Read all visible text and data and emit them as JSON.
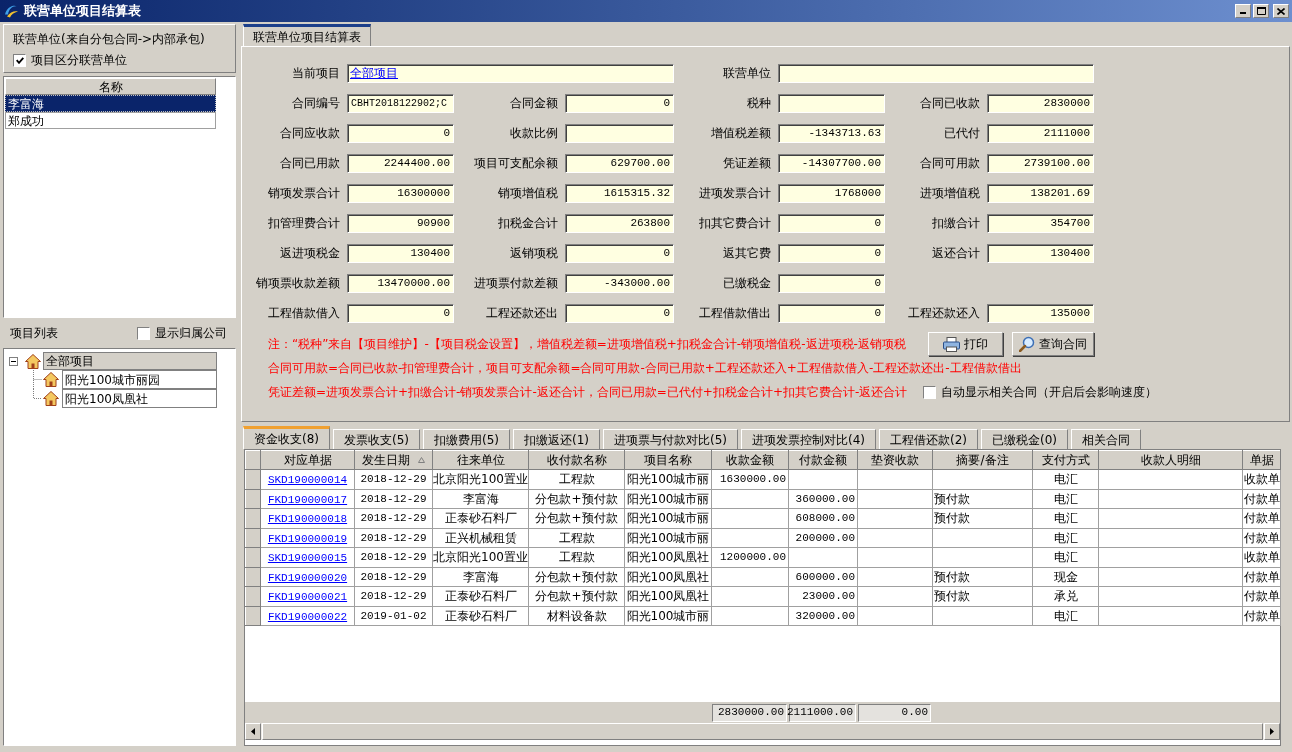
{
  "window": {
    "title": "联营单位项目结算表"
  },
  "left_panel": {
    "group_label": "联营单位(来自分包合同->内部承包)",
    "split_checkbox": {
      "label": "项目区分联营单位",
      "checked": true
    },
    "unit_list": {
      "column": "名称",
      "items": [
        {
          "name": "李富海",
          "selected": true
        },
        {
          "name": "郑成功",
          "selected": false
        }
      ]
    },
    "project_list": {
      "label": "项目列表",
      "company_checkbox": {
        "label": "显示归属公司",
        "checked": false
      },
      "tree": [
        {
          "label": "全部项目",
          "expanded": true,
          "selected": true,
          "children": [
            {
              "label": "阳光100城市丽园",
              "selected": false
            },
            {
              "label": "阳光100凤凰社",
              "selected": false
            }
          ]
        }
      ]
    }
  },
  "main_tabs": [
    {
      "label": "联营单位项目结算表",
      "selected": true
    }
  ],
  "form": {
    "current_project": {
      "label": "当前项目",
      "value": "全部项目"
    },
    "joint_unit": {
      "label": "联营单位"
    },
    "rows": [
      [
        {
          "label": "合同编号",
          "value": "CBHT2018122902;C",
          "kind": "text"
        },
        {
          "label": "合同金额",
          "value": "0",
          "kind": "number"
        },
        {
          "label": "税种"
        },
        {
          "label": "合同已收款",
          "value": "2830000",
          "kind": "number"
        }
      ],
      [
        {
          "label": "合同应收款",
          "value": "0",
          "kind": "number"
        },
        {
          "label": "收款比例"
        },
        {
          "label": "增值税差额",
          "value": "-1343713.63",
          "kind": "number"
        },
        {
          "label": "已代付",
          "value": "2111000",
          "kind": "number"
        }
      ],
      [
        {
          "label": "合同已用款",
          "value": "2244400.00",
          "kind": "number"
        },
        {
          "label": "项目可支配余额",
          "value": "629700.00",
          "kind": "number"
        },
        {
          "label": "凭证差额",
          "value": "-14307700.00",
          "kind": "number"
        },
        {
          "label": "合同可用款",
          "value": "2739100.00",
          "kind": "number"
        }
      ],
      [
        {
          "label": "销项发票合计",
          "value": "16300000",
          "kind": "number"
        },
        {
          "label": "销项增值税",
          "value": "1615315.32",
          "kind": "number"
        },
        {
          "label": "进项发票合计",
          "value": "1768000",
          "kind": "number"
        },
        {
          "label": "进项增值税",
          "value": "138201.69",
          "kind": "number"
        }
      ],
      [
        {
          "label": "扣管理费合计",
          "value": "90900",
          "kind": "number"
        },
        {
          "label": "扣税金合计",
          "value": "263800",
          "kind": "number"
        },
        {
          "label": "扣其它费合计",
          "value": "0",
          "kind": "number"
        },
        {
          "label": "扣缴合计",
          "value": "354700",
          "kind": "number"
        }
      ],
      [
        {
          "label": "返进项税金",
          "value": "130400",
          "kind": "number"
        },
        {
          "label": "返销项税",
          "value": "0",
          "kind": "number"
        },
        {
          "label": "返其它费",
          "value": "0",
          "kind": "number"
        },
        {
          "label": "返还合计",
          "value": "130400",
          "kind": "number"
        }
      ],
      [
        {
          "label": "销项票收款差额",
          "value": "13470000.00",
          "kind": "number"
        },
        {
          "label": "进项票付款差额",
          "value": "-343000.00",
          "kind": "number"
        },
        {
          "label": "已缴税金",
          "value": "0",
          "kind": "number"
        }
      ],
      [
        {
          "label": "工程借款借入",
          "value": "0",
          "kind": "number"
        },
        {
          "label": "工程还款还出",
          "value": "0",
          "kind": "number"
        },
        {
          "label": "工程借款借出",
          "value": "0",
          "kind": "number"
        },
        {
          "label": "工程还款还入",
          "value": "135000",
          "kind": "number"
        }
      ]
    ]
  },
  "notes": [
    "注：“税种”来自【项目维护】-【项目税金设置】，增值税差额=进项增值税+扣税金合计-销项增值税-返进项税-返销项税",
    "合同可用款=合同已收款-扣管理费合计，项目可支配余额=合同可用款-合同已用款+工程还款还入+工程借款借入-工程还款还出-工程借款借出",
    "凭证差额=进项发票合计+扣缴合计-销项发票合计-返还合计，合同已用款=已代付+扣税金合计+扣其它费合计-返还合计"
  ],
  "buttons": [
    {
      "label": "打印",
      "kind": "print"
    },
    {
      "label": "查询合同",
      "kind": "query"
    }
  ],
  "auto_show_checkbox": {
    "label": "自动显示相关合同（开启后会影响速度）",
    "checked": false
  },
  "detail_tabs": [
    {
      "label": "资金收支(8)",
      "selected": true
    },
    {
      "label": "发票收支(5)",
      "selected": false
    },
    {
      "label": "扣缴费用(5)",
      "selected": false
    },
    {
      "label": "扣缴返还(1)",
      "selected": false
    },
    {
      "label": "进项票与付款对比(5)",
      "selected": false
    },
    {
      "label": "进项发票控制对比(4)",
      "selected": false
    },
    {
      "label": "工程借还款(2)",
      "selected": false
    },
    {
      "label": "已缴税金(0)",
      "selected": false
    },
    {
      "label": "相关合同",
      "selected": false
    }
  ],
  "table": {
    "columns": [
      {
        "label": "对应单据",
        "kind": "link",
        "sorted": false
      },
      {
        "label": "发生日期",
        "kind": "date",
        "sorted": true
      },
      {
        "label": "往来单位",
        "kind": "text",
        "sorted": false
      },
      {
        "label": "收付款名称",
        "kind": "text",
        "sorted": false
      },
      {
        "label": "项目名称",
        "kind": "text",
        "sorted": false
      },
      {
        "label": "收款金额",
        "kind": "amount",
        "sorted": false,
        "total": "2830000.00"
      },
      {
        "label": "付款金额",
        "kind": "amount",
        "sorted": false,
        "total": "2111000.00"
      },
      {
        "label": "垫资收款",
        "kind": "amount",
        "sorted": false,
        "total": "0.00"
      },
      {
        "label": "摘要/备注",
        "kind": "memo",
        "sorted": false
      },
      {
        "label": "支付方式",
        "kind": "text",
        "sorted": false
      },
      {
        "label": "收款人明细",
        "sorted": false
      },
      {
        "label": "单据",
        "kind": "memo",
        "sorted": false
      }
    ],
    "rows": [
      [
        "SKD190000014",
        "2018-12-29",
        "北京阳光100置业",
        "工程款",
        "阳光100城市丽",
        "1630000.00",
        null,
        null,
        null,
        "电汇",
        null,
        "收款单"
      ],
      [
        "FKD190000017",
        "2018-12-29",
        "李富海",
        "分包款+预付款",
        "阳光100城市丽",
        null,
        "360000.00",
        null,
        "预付款",
        "电汇",
        null,
        "付款单"
      ],
      [
        "FKD190000018",
        "2018-12-29",
        "正泰砂石料厂",
        "分包款+预付款",
        "阳光100城市丽",
        null,
        "608000.00",
        null,
        "预付款",
        "电汇",
        null,
        "付款单"
      ],
      [
        "FKD190000019",
        "2018-12-29",
        "正兴机械租赁",
        "工程款",
        "阳光100城市丽",
        null,
        "200000.00",
        null,
        null,
        "电汇",
        null,
        "付款单"
      ],
      [
        "SKD190000015",
        "2018-12-29",
        "北京阳光100置业",
        "工程款",
        "阳光100凤凰社",
        "1200000.00",
        null,
        null,
        null,
        "电汇",
        null,
        "收款单"
      ],
      [
        "FKD190000020",
        "2018-12-29",
        "李富海",
        "分包款+预付款",
        "阳光100凤凰社",
        null,
        "600000.00",
        null,
        "预付款",
        "现金",
        null,
        "付款单"
      ],
      [
        "FKD190000021",
        "2018-12-29",
        "正泰砂石料厂",
        "分包款+预付款",
        "阳光100凤凰社",
        null,
        "23000.00",
        null,
        "预付款",
        "承兑",
        null,
        "付款单"
      ],
      [
        "FKD190000022",
        "2019-01-02",
        "正泰砂石料厂",
        "材料设备款",
        "阳光100城市丽",
        null,
        "320000.00",
        null,
        null,
        "电汇",
        null,
        "付款单"
      ]
    ]
  }
}
